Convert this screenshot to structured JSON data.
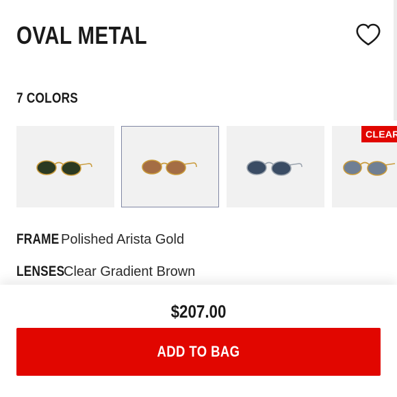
{
  "product": {
    "title": "OVAL METAL"
  },
  "colors": {
    "count_label": "7 COLORS",
    "swatches": [
      {
        "name": "gold-frame-green-lens",
        "frame_color": "#c99a3a",
        "lens_color": "#2b3a22",
        "selected": false
      },
      {
        "name": "gold-frame-brown-gradient-lens",
        "frame_color": "#c99a3a",
        "lens_color": "#a46d44",
        "selected": true
      },
      {
        "name": "silver-frame-blue-lens",
        "frame_color": "#9aa3ad",
        "lens_color": "#3a4c64",
        "selected": false
      },
      {
        "name": "gold-frame-gray-blue-lens",
        "frame_color": "#c99a3a",
        "lens_color": "#6f7f94",
        "selected": false
      }
    ],
    "badge_label": "CLEAR"
  },
  "specs": {
    "frame_label": "FRAME",
    "frame_value": "Polished Arista Gold",
    "lenses_label": "LENSES",
    "lenses_value": "Clear Gradient Brown"
  },
  "purchase": {
    "price": "$207.00",
    "add_to_bag_label": "ADD TO BAG"
  },
  "colors_palette": {
    "accent": "#e10600",
    "text": "#1a1a1a",
    "swatch_bg": "#f1f1f1",
    "selected_border": "#7f86a3"
  },
  "icons": {
    "wishlist": "heart-outline-icon"
  }
}
